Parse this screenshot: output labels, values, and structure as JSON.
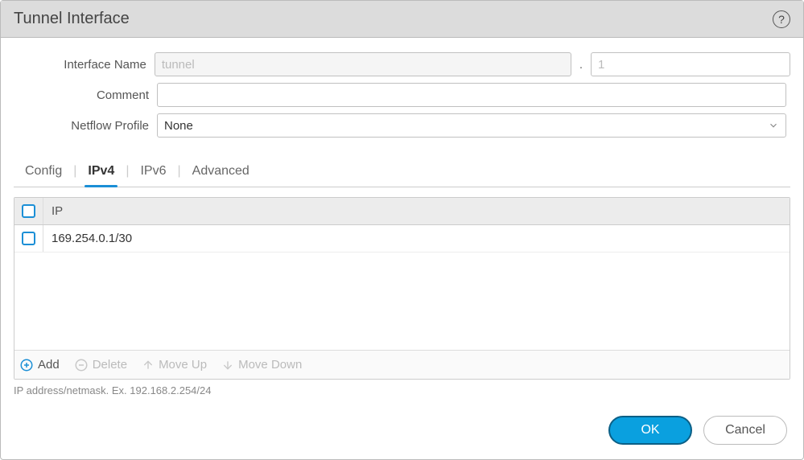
{
  "dialog": {
    "title": "Tunnel Interface"
  },
  "form": {
    "interface_name": {
      "label": "Interface Name",
      "placeholder": "tunnel",
      "value": "",
      "suffix_placeholder": "1",
      "suffix_value": ""
    },
    "comment": {
      "label": "Comment",
      "value": ""
    },
    "netflow": {
      "label": "Netflow Profile",
      "value": "None"
    }
  },
  "tabs": [
    "Config",
    "IPv4",
    "IPv6",
    "Advanced"
  ],
  "active_tab": "IPv4",
  "table": {
    "header": "IP",
    "rows": [
      {
        "ip": "169.254.0.1/30",
        "checked": false
      }
    ]
  },
  "toolbar": {
    "add": "Add",
    "delete": "Delete",
    "moveup": "Move Up",
    "movedown": "Move Down"
  },
  "hint": "IP address/netmask. Ex. 192.168.2.254/24",
  "footer": {
    "ok": "OK",
    "cancel": "Cancel"
  }
}
